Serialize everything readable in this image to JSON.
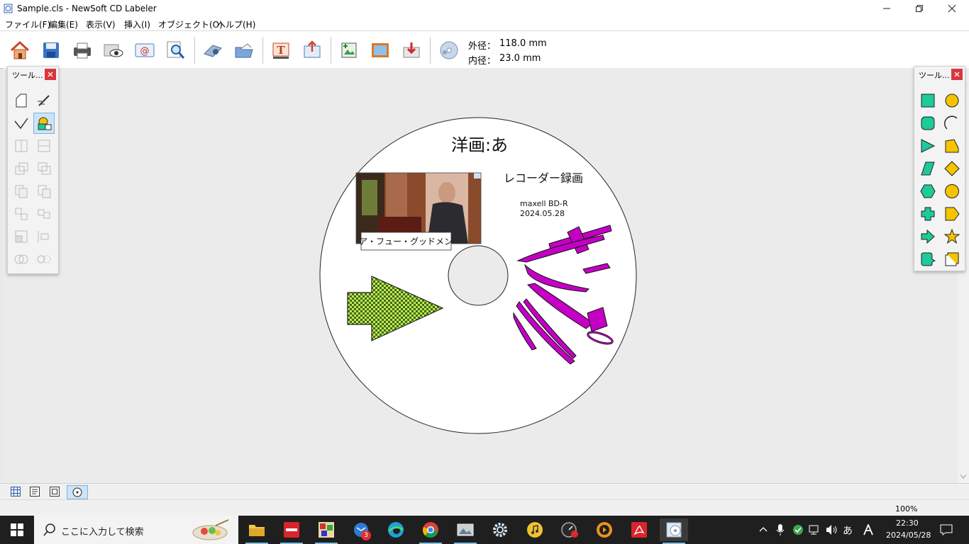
{
  "window": {
    "title": "Sample.cls - NewSoft CD Labeler"
  },
  "menu": [
    "ファイル(F)",
    "編集(E)",
    "表示(V)",
    "挿入(I)",
    "オブジェクト(O)",
    "ヘルプ(H)"
  ],
  "toolbar": {
    "outer_label": "外径：",
    "outer_value": "118.0 mm",
    "inner_label": "内径：",
    "inner_value": "23.0 mm"
  },
  "palette_left": {
    "title": "ツール..."
  },
  "palette_right": {
    "title": "ツール..."
  },
  "label": {
    "title": "洋画:あ",
    "subtitle": "レコーダー録画",
    "media": "maxell  BD-R",
    "date": "2024.05.28",
    "photo_caption": "ア・フュー・グッドメン",
    "disc_outer_mm": 118.0,
    "disc_inner_mm": 23.0
  },
  "statusbar": {
    "zoom": "100%"
  },
  "taskbar": {
    "search_placeholder": "ここに入力して検索",
    "mail_badge": "3",
    "ime": "あ",
    "time": "22:30",
    "date": "2024/05/28"
  },
  "colors": {
    "palette_shape": "#1ec99a",
    "palette_shape_alt": "#f5c400",
    "arrow_fill": "#b8e04a",
    "graffiti": "#c400c4"
  }
}
